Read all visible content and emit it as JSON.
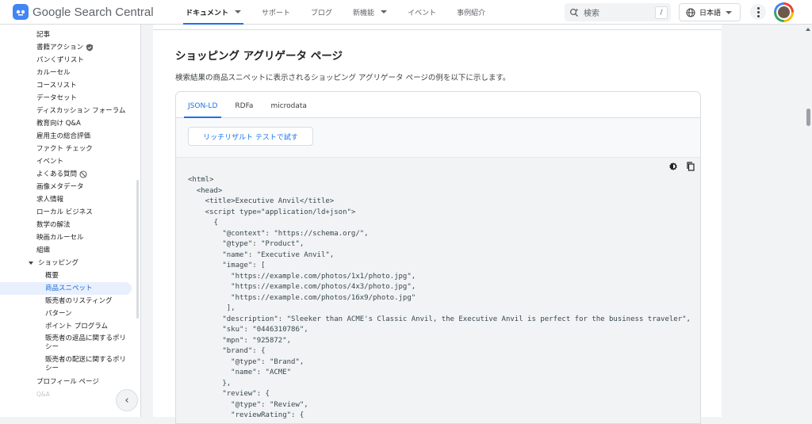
{
  "header": {
    "logo_text": "Google Search Central",
    "nav": [
      {
        "label": "ドキュメント",
        "active": true,
        "dropdown": true
      },
      {
        "label": "サポート"
      },
      {
        "label": "ブログ"
      },
      {
        "label": "新機能",
        "dropdown": true
      },
      {
        "label": "イベント"
      },
      {
        "label": "事例紹介"
      }
    ],
    "search_placeholder": "検索",
    "search_shortcut": "/",
    "language": "日本語"
  },
  "sidebar": {
    "items": [
      {
        "label": "記事"
      },
      {
        "label": "書籍アクション",
        "icon": "verified-badge-icon"
      },
      {
        "label": "パンくずリスト"
      },
      {
        "label": "カルーセル"
      },
      {
        "label": "コースリスト"
      },
      {
        "label": "データセット"
      },
      {
        "label": "ディスカッション フォーラム"
      },
      {
        "label": "教育向け Q&A"
      },
      {
        "label": "雇用主の総合評価"
      },
      {
        "label": "ファクト チェック"
      },
      {
        "label": "イベント"
      },
      {
        "label": "よくある質問",
        "icon": "prohibited-icon"
      },
      {
        "label": "画像メタデータ"
      },
      {
        "label": "求人情報"
      },
      {
        "label": "ローカル ビジネス"
      },
      {
        "label": "数学の解法"
      },
      {
        "label": "映画カルーセル"
      },
      {
        "label": "組織"
      },
      {
        "label": "ショッピング",
        "expander": true
      },
      {
        "label": "概要",
        "sub": true
      },
      {
        "label": "商品スニペット",
        "sub": true,
        "selected": true
      },
      {
        "label": "販売者のリスティング",
        "sub": true
      },
      {
        "label": "パターン",
        "sub": true
      },
      {
        "label": "ポイント プログラム",
        "sub": true
      },
      {
        "label": "販売者の返品に関するポリシー",
        "sub": true,
        "multi": true
      },
      {
        "label": "販売者の配送に関するポリシー",
        "sub": true,
        "multi": true
      },
      {
        "label": "プロフィール ページ"
      },
      {
        "label": "Q&A",
        "faded": true
      }
    ]
  },
  "main": {
    "heading": "ショッピング アグリゲータ ページ",
    "description": "検索結果の商品スニペットに表示されるショッピング アグリゲータ ページの例を以下に示します。",
    "tabs": [
      "JSON-LD",
      "RDFa",
      "microdata"
    ],
    "active_tab": "JSON-LD",
    "rich_results_button": "リッチリザルト テストで試す",
    "code": "<html>\n  <head>\n    <title>Executive Anvil</title>\n    <script type=\"application/ld+json\">\n      {\n        \"@context\": \"https://schema.org/\",\n        \"@type\": \"Product\",\n        \"name\": \"Executive Anvil\",\n        \"image\": [\n          \"https://example.com/photos/1x1/photo.jpg\",\n          \"https://example.com/photos/4x3/photo.jpg\",\n          \"https://example.com/photos/16x9/photo.jpg\"\n         ],\n        \"description\": \"Sleeker than ACME's Classic Anvil, the Executive Anvil is perfect for the business traveler\",\n        \"sku\": \"0446310786\",\n        \"mpn\": \"925872\",\n        \"brand\": {\n          \"@type\": \"Brand\",\n          \"name\": \"ACME\"\n        },\n        \"review\": {\n          \"@type\": \"Review\",\n          \"reviewRating\": {"
  },
  "colors": {
    "accent": "#1a73e8",
    "selected_bg": "#e8f0fe",
    "code_bg": "#f1f3f4"
  }
}
